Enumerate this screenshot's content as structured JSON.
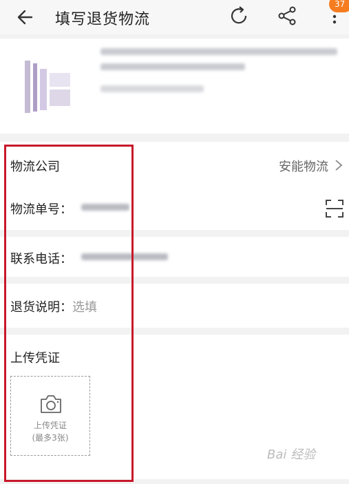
{
  "header": {
    "title": "填写退货物流",
    "badge": "37",
    "icons": [
      "back-arrow-icon",
      "refresh-icon",
      "share-icon",
      "more-icon"
    ]
  },
  "form": {
    "company_label": "物流公司",
    "company_value": "安能物流",
    "tracking_label": "物流单号：",
    "phone_label": "联系电话：",
    "note_label": "退货说明：",
    "note_placeholder": "选填",
    "proof_label": "上传凭证",
    "upload_line1": "上传凭证",
    "upload_line2": "(最多3张)"
  },
  "colors": {
    "badge": "#f57c1f",
    "highlight_box": "#c8182a",
    "background": "#f2f2f2"
  },
  "watermark": "Bai 经验"
}
